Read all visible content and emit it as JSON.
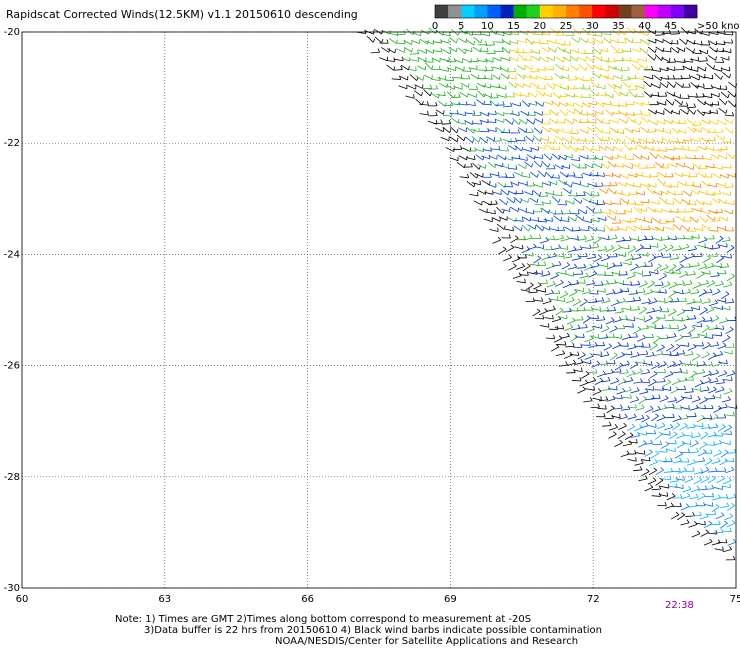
{
  "header": {
    "title": "Rapidscat Corrected Winds(12.5KM) v1.1 20150610 descending"
  },
  "legend": {
    "colors": [
      "#404040",
      "#909090",
      "#00d0ff",
      "#00a0ff",
      "#0060ff",
      "#0020c0",
      "#00b000",
      "#20d020",
      "#ffd000",
      "#ffb000",
      "#ff8000",
      "#ff5000",
      "#ff0000",
      "#d00000",
      "#704020",
      "#a06040",
      "#ff00ff",
      "#c000ff",
      "#8000ff",
      "#4000a0"
    ],
    "labels": [
      "0",
      "5",
      "10",
      "15",
      "20",
      "25",
      "30",
      "35",
      "40",
      "45",
      ">50 knots"
    ]
  },
  "axes": {
    "y_ticks": [
      "-20",
      "-22",
      "-24",
      "-26",
      "-28",
      "-30"
    ],
    "x_ticks": [
      "60",
      "63",
      "66",
      "69",
      "72",
      "75"
    ]
  },
  "chart_data": {
    "type": "scatter",
    "title": "Rapidscat Corrected Winds(12.5KM) v1.1 20150610 descending",
    "xlim": [
      60,
      75
    ],
    "ylim": [
      -30,
      -20
    ],
    "grid": true,
    "units": "knots",
    "swath_edge": [
      [
        67.2,
        -20
      ],
      [
        69,
        -22
      ],
      [
        71.5,
        -26
      ],
      [
        73.5,
        -28.5
      ],
      [
        75,
        -29.5
      ]
    ],
    "speed_regions": [
      {
        "lon": [
          69.5,
          72.5
        ],
        "lat": [
          -20,
          -21.5
        ],
        "color_class": "green/yellow",
        "speed_knots": 20
      },
      {
        "lon": [
          71.5,
          75
        ],
        "lat": [
          -21,
          -23.5
        ],
        "color_class": "yellow/orange",
        "speed_knots": 25
      },
      {
        "lon": [
          69,
          72
        ],
        "lat": [
          -22,
          -23.5
        ],
        "color_class": "blue",
        "speed_knots": 14
      },
      {
        "lon": [
          70,
          75
        ],
        "lat": [
          -23.5,
          -25.5
        ],
        "color_class": "blue/green",
        "speed_knots": 15
      },
      {
        "lon": [
          71,
          75
        ],
        "lat": [
          -25.5,
          -27
        ],
        "color_class": "blue",
        "speed_knots": 13
      },
      {
        "lon": [
          73,
          75
        ],
        "lat": [
          -27,
          -28.5
        ],
        "color_class": "cyan",
        "speed_knots": 8
      }
    ]
  },
  "time_label": "22:38",
  "notes": {
    "line1": "Note: 1) Times are GMT 2)Times along bottom correspond to measurement at -20S",
    "line2": "3)Data buffer is 22 hrs from 20150610 4) Black wind barbs indicate possible contamination",
    "line3": "NOAA/NESDIS/Center for Satellite Applications and Research"
  }
}
